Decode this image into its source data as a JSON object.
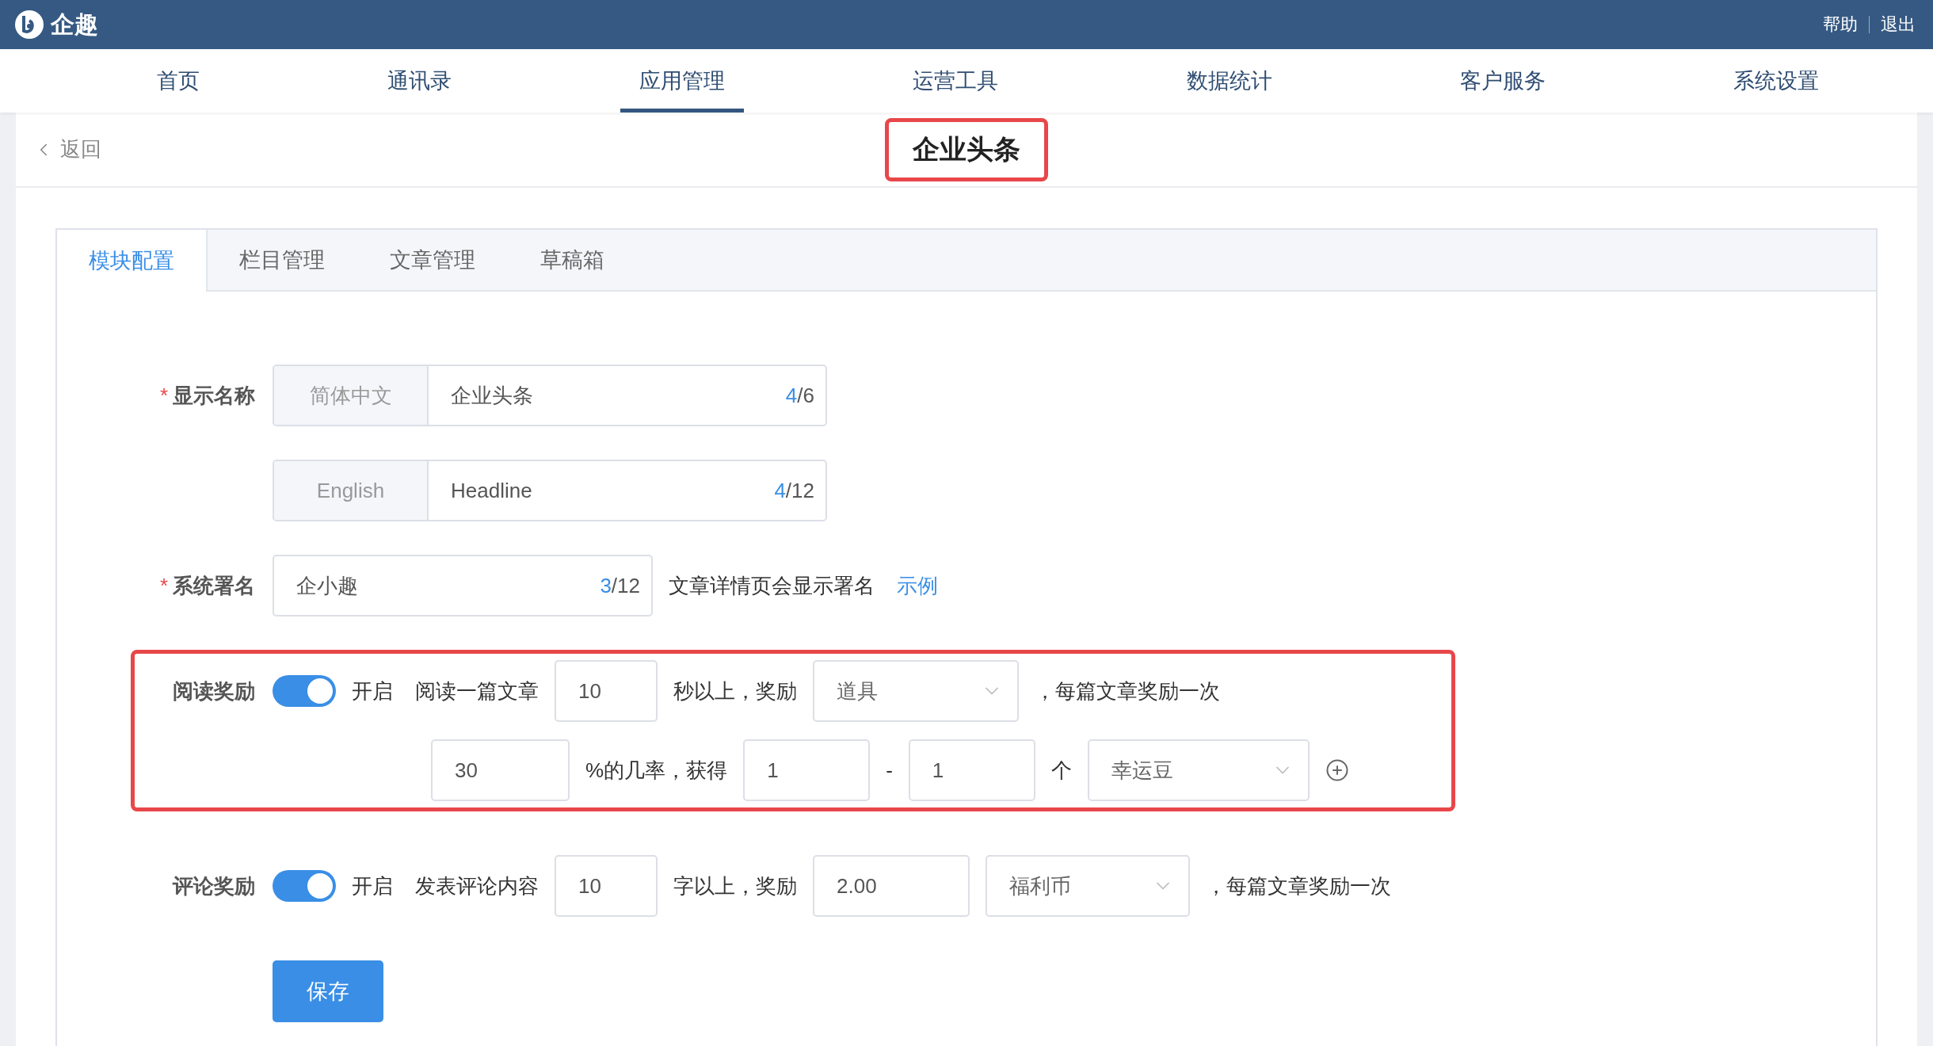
{
  "topbar": {
    "brand": "企趣",
    "links": [
      {
        "label": "帮助"
      },
      {
        "label": "退出"
      }
    ]
  },
  "nav": [
    {
      "label": "首页",
      "selected": false
    },
    {
      "label": "通讯录",
      "selected": false
    },
    {
      "label": "应用管理",
      "selected": true
    },
    {
      "label": "运营工具",
      "selected": false
    },
    {
      "label": "数据统计",
      "selected": false
    },
    {
      "label": "客户服务",
      "selected": false
    },
    {
      "label": "系统设置",
      "selected": false
    }
  ],
  "header": {
    "back": "返回",
    "title": "企业头条"
  },
  "tabs": [
    {
      "label": "模块配置",
      "selected": true
    },
    {
      "label": "栏目管理",
      "selected": false
    },
    {
      "label": "文章管理",
      "selected": false
    },
    {
      "label": "草稿箱",
      "selected": false
    }
  ],
  "display_name": {
    "label": "显示名称",
    "required_mark": "*",
    "rows": [
      {
        "prefix": "简体中文",
        "value": "企业头条",
        "count": "4",
        "limit": "/6"
      },
      {
        "prefix": "English",
        "value": "Headline",
        "count": "4",
        "limit": "/12"
      }
    ]
  },
  "signature": {
    "label": "系统署名",
    "required_mark": "*",
    "value": "企小趣",
    "count": "3",
    "limit": "/12",
    "hint": "文章详情页会显示署名",
    "link": "示例"
  },
  "rewards": [
    {
      "label": "阅读奖励",
      "on": true,
      "on_label": "开启",
      "highlighted": true,
      "lines": [
        [
          {
            "kind": "text",
            "text": "阅读一篇文章"
          },
          {
            "kind": "input",
            "value": "10"
          },
          {
            "kind": "text",
            "text": "秒以上，奖励"
          },
          {
            "kind": "select",
            "value": "道具"
          },
          {
            "kind": "text",
            "text": "，每篇文章奖励一次"
          }
        ],
        [
          {
            "kind": "input",
            "value": "30"
          },
          {
            "kind": "text",
            "text": "%的几率，获得"
          },
          {
            "kind": "input",
            "value": "1"
          },
          {
            "kind": "text",
            "text": "-"
          },
          {
            "kind": "input",
            "value": "1"
          },
          {
            "kind": "text",
            "text": "个"
          },
          {
            "kind": "select",
            "value": "幸运豆"
          },
          {
            "kind": "add"
          }
        ]
      ]
    },
    {
      "label": "评论奖励",
      "on": true,
      "on_label": "开启",
      "highlighted": false,
      "lines": [
        [
          {
            "kind": "text",
            "text": "发表评论内容"
          },
          {
            "kind": "input",
            "value": "10"
          },
          {
            "kind": "text",
            "text": "字以上，奖励"
          },
          {
            "kind": "input",
            "value": "2.00"
          },
          {
            "kind": "select",
            "value": "福利币"
          },
          {
            "kind": "text",
            "text": "，每篇文章奖励一次"
          }
        ]
      ]
    }
  ],
  "save": "保存"
}
